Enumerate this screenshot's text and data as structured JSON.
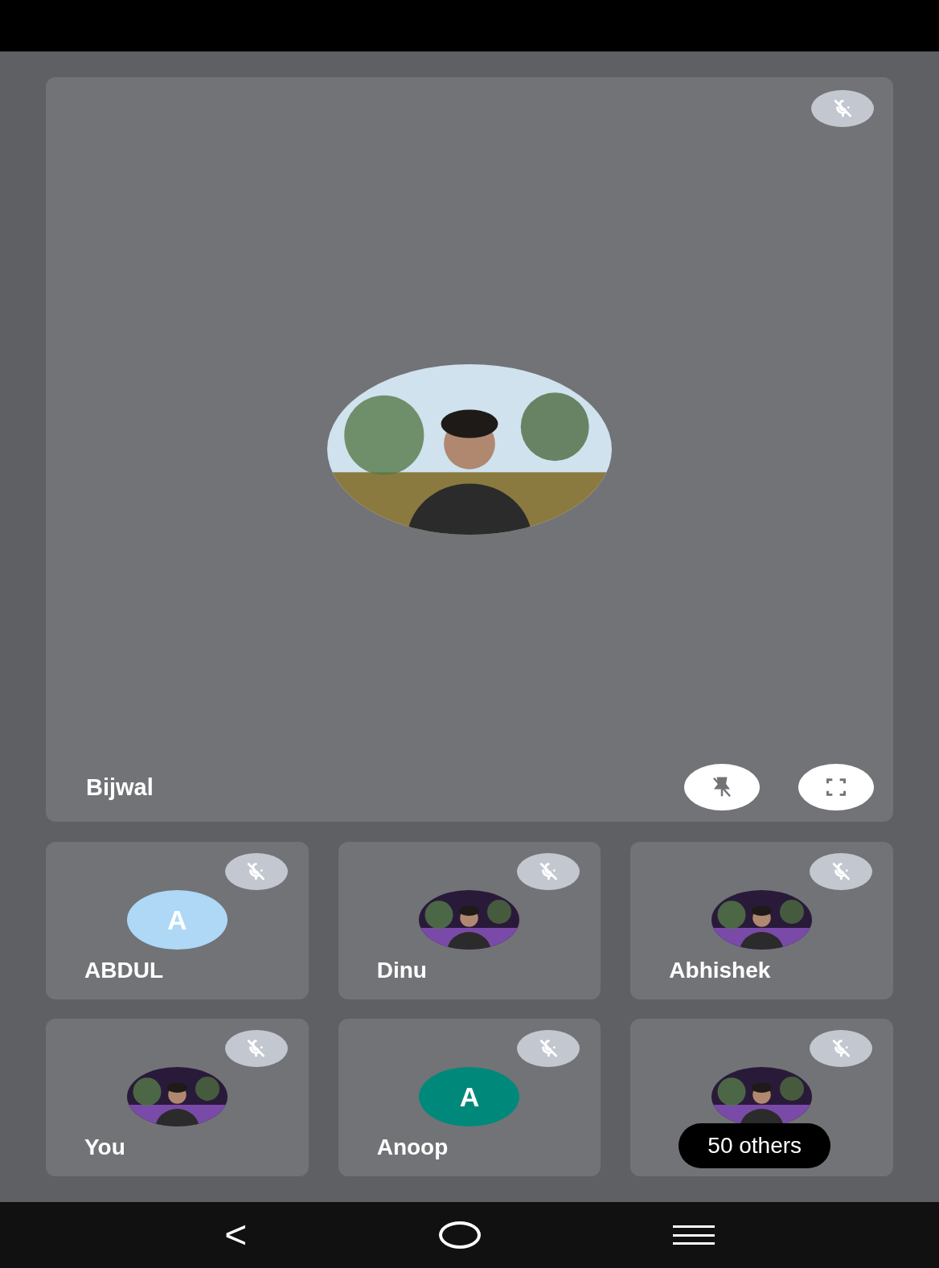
{
  "main_tile": {
    "name": "Bijwal",
    "muted": true
  },
  "tiles": [
    {
      "name": "ABDUL",
      "muted": true,
      "avatar": {
        "kind": "initial",
        "letter": "A",
        "color": "#aed8f5"
      }
    },
    {
      "name": "Dinu",
      "muted": true
    },
    {
      "name": "Abhishek",
      "muted": true
    },
    {
      "name": "You",
      "muted": true
    },
    {
      "name": "Anoop",
      "muted": true,
      "avatar": {
        "kind": "initial",
        "letter": "A",
        "color": "#00897b"
      }
    },
    {
      "muted": true,
      "badge": "50 others"
    }
  ],
  "nav_bar": {
    "back": "<"
  }
}
